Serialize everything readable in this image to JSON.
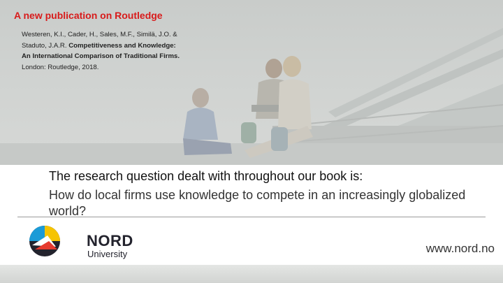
{
  "publication": {
    "heading": "A new publication on Routledge",
    "citation_authors": "Westeren, K.I., Cader, H., Sales, M.F., Similä, J.O. & Staduto, J.A.R.",
    "citation_title": "Competitiveness and Knowledge: An International Comparison of Traditional Firms.",
    "citation_publisher": "London: Routledge, 2018."
  },
  "research": {
    "heading": "The research question dealt with throughout our book is:",
    "question": "How do local firms use knowledge to compete in an increasingly globalized world?"
  },
  "footer": {
    "logo_word": "NORD",
    "logo_sub": "University",
    "url": "www.nord.no"
  },
  "colors": {
    "accent": "#d81b1b",
    "logo_dark": "#23232d"
  }
}
